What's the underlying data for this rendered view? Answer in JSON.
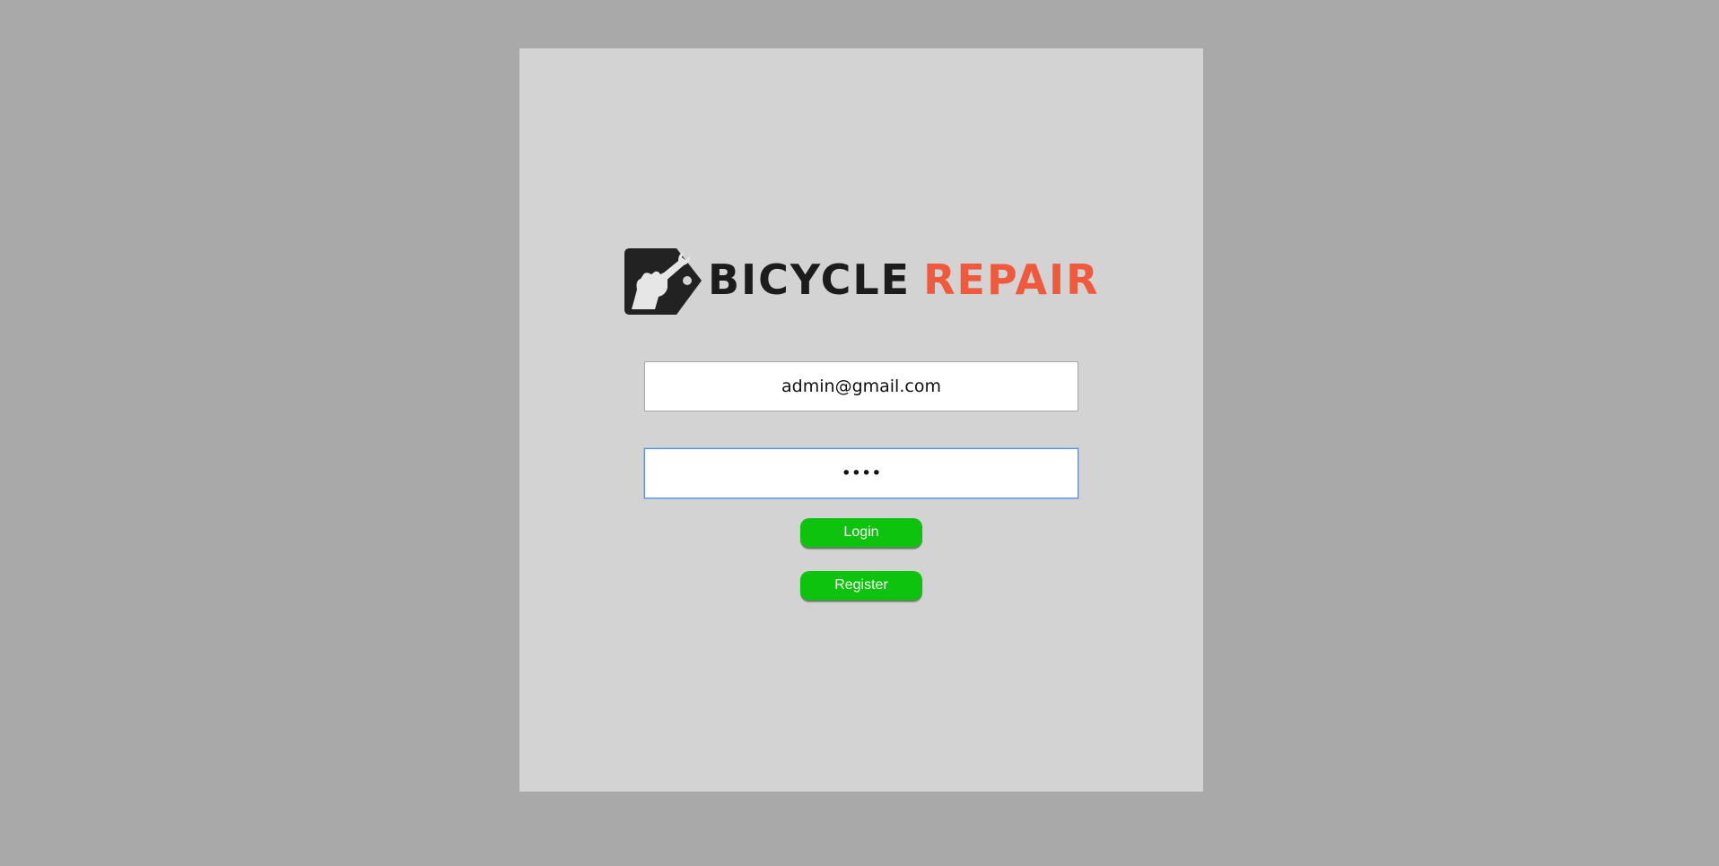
{
  "logo": {
    "text_primary": "BICYCLE",
    "text_accent": "REPAIR",
    "icon": "fist-wrench-tag-icon"
  },
  "form": {
    "email_value": "admin@gmail.com",
    "password_value": "••••",
    "login_label": "Login",
    "register_label": "Register"
  },
  "colors": {
    "page_background": "#a9a9a9",
    "panel_background": "#d3d3d3",
    "button_green": "#0dc30d",
    "brand_accent": "#f05a3c",
    "brand_dark": "#1c1c1c"
  }
}
